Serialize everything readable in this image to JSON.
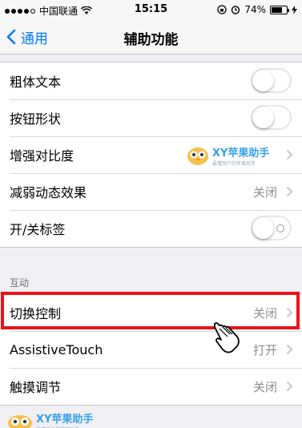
{
  "status_bar": {
    "carrier": "中国联通",
    "time": "15:15",
    "battery_percent": "74%",
    "battery_level": 0.74,
    "icons": [
      "signal-dots-icon",
      "wifi-icon",
      "lock-rotation-icon",
      "alarm-icon",
      "battery-icon",
      "charging-bolt-icon"
    ]
  },
  "nav": {
    "back_label": "通用",
    "title": "辅助功能"
  },
  "group1": {
    "rows": [
      {
        "label": "粗体文本",
        "control": "toggle",
        "on": false
      },
      {
        "label": "按钮形状",
        "control": "toggle",
        "on": false
      },
      {
        "label": "增强对比度",
        "control": "chevron",
        "value": ""
      },
      {
        "label": "减弱动态效果",
        "control": "chevron",
        "value": "关闭"
      },
      {
        "label": "开/关标签",
        "control": "toggle",
        "on": false
      }
    ]
  },
  "interaction_section": {
    "header": "互动",
    "rows": [
      {
        "label": "切换控制",
        "value": "关闭"
      },
      {
        "label": "AssistiveTouch",
        "value": "打开"
      },
      {
        "label": "触摸调节",
        "value": "关闭"
      }
    ]
  },
  "watermark": {
    "brand": "XY苹果助手",
    "tagline": "最懂用户的苹果助手"
  },
  "colors": {
    "accent": "#007aff",
    "highlight": "#e8141b",
    "watermark": "#3aa0e8"
  }
}
